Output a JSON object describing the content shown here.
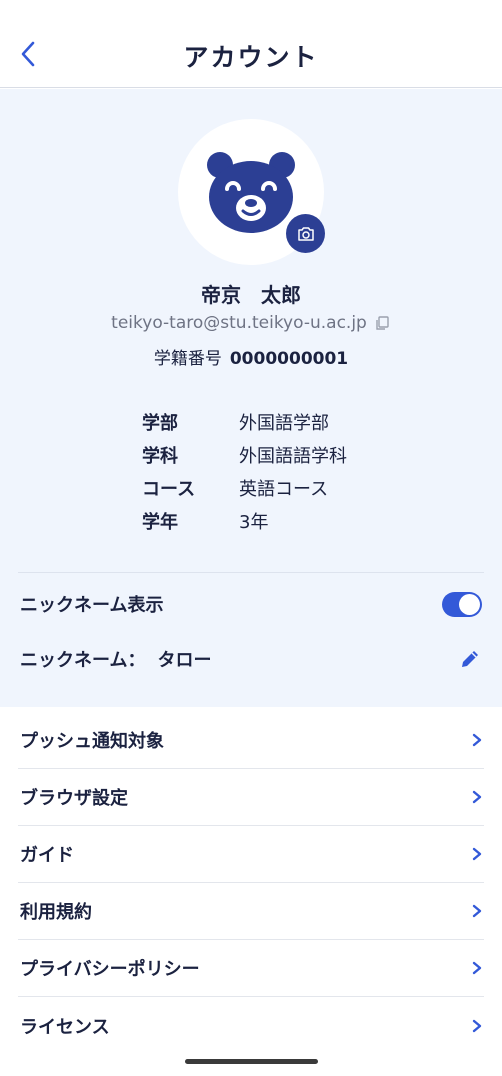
{
  "header": {
    "title": "アカウント",
    "back_icon": "chevron-left-icon"
  },
  "profile": {
    "name": "帝京　太郎",
    "email": "teikyo-taro@stu.teikyo-u.ac.jp",
    "student_id_label": "学籍番号",
    "student_id_value": "0000000001",
    "info": [
      {
        "label": "学部",
        "value": "外国語学部"
      },
      {
        "label": "学科",
        "value": "外国語語学科"
      },
      {
        "label": "コース",
        "value": "英語コース"
      },
      {
        "label": "学年",
        "value": "3年"
      }
    ]
  },
  "nickname": {
    "toggle_label": "ニックネーム表示",
    "toggle_on": true,
    "name_label": "ニックネーム：",
    "name_value": "タロー"
  },
  "menu": [
    {
      "label": "プッシュ通知対象"
    },
    {
      "label": "ブラウザ設定"
    },
    {
      "label": "ガイド"
    },
    {
      "label": "利用規約"
    },
    {
      "label": "プライバシーポリシー"
    },
    {
      "label": "ライセンス"
    }
  ],
  "colors": {
    "accent": "#3359d8",
    "navy": "#2c3f94",
    "text": "#1b2240",
    "profile_bg": "#f0f5fd"
  }
}
